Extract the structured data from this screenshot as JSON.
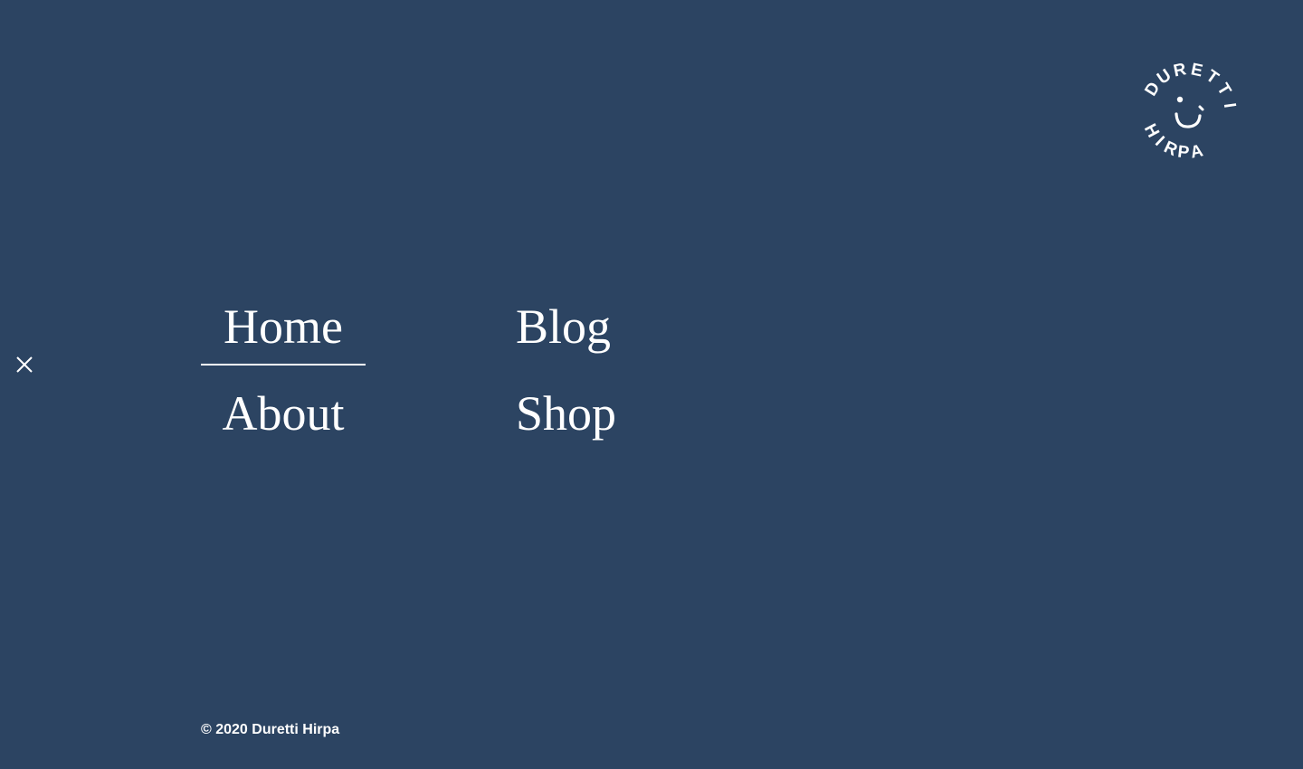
{
  "colors": {
    "background": "#2c4462",
    "foreground": "#ffffff"
  },
  "close_button": {
    "icon": "close-icon"
  },
  "logo": {
    "top_text": "DURETTI",
    "bottom_text": "HIRPA",
    "icon": "smiley-face-icon"
  },
  "nav": {
    "items": [
      {
        "label": "Home",
        "active": true
      },
      {
        "label": "Blog",
        "active": false
      },
      {
        "label": "About",
        "active": false
      },
      {
        "label": "Shop",
        "active": false
      }
    ]
  },
  "footer": {
    "copyright": "© 2020 Duretti Hirpa"
  }
}
